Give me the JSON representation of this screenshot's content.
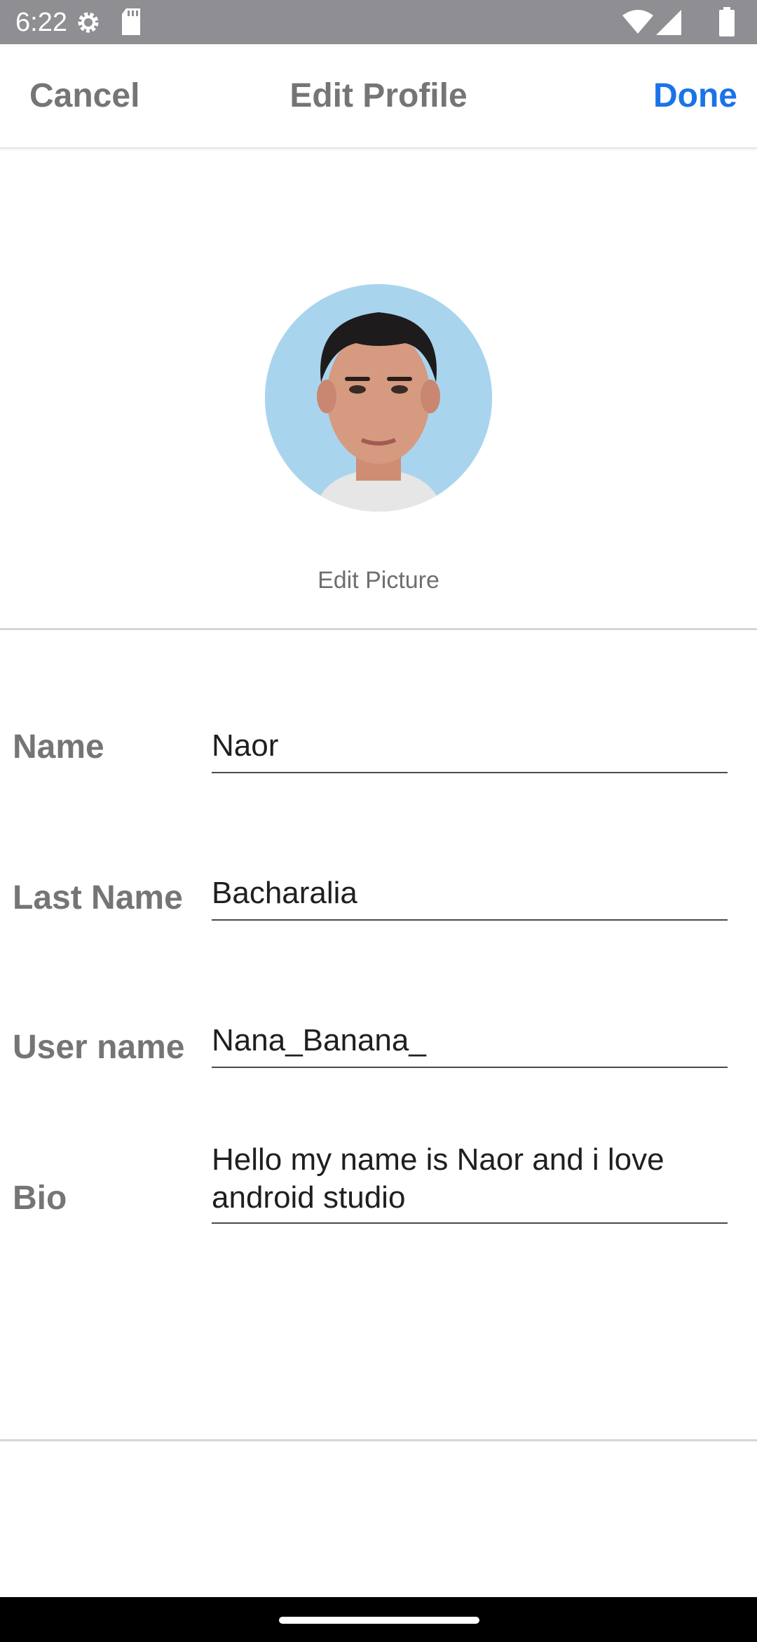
{
  "status_bar": {
    "time": "6:22",
    "icons": [
      "settings-icon",
      "sd-card-icon",
      "wifi-icon",
      "signal-icon",
      "battery-icon"
    ]
  },
  "header": {
    "cancel_label": "Cancel",
    "title": "Edit Profile",
    "done_label": "Done"
  },
  "profile": {
    "edit_picture_label": "Edit Picture"
  },
  "form": {
    "name_label": "Name",
    "name_value": "Naor",
    "last_name_label": "Last Name",
    "last_name_value": "Bacharalia",
    "username_label": "User name",
    "username_value": "Nana_Banana_",
    "bio_label": "Bio",
    "bio_value": "Hello my name is Naor and i love android studio"
  },
  "colors": {
    "accent": "#1a73e8",
    "status_bar": "#8e8e93",
    "label_gray": "#757575"
  }
}
